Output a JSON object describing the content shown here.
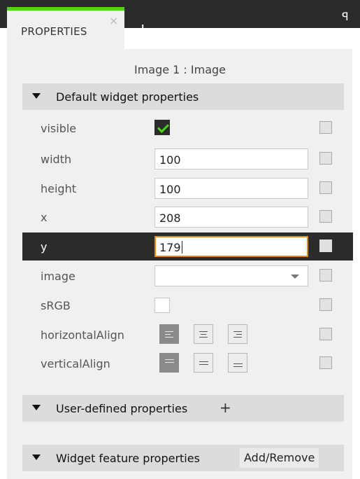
{
  "tab": {
    "label": "PROPERTIES",
    "close_glyph": "×",
    "add_glyph": "+",
    "pin_glyph": "ꟼ"
  },
  "colors": {
    "accent_green": "#4cd51a",
    "dark_bar": "#2b2b2b",
    "focus_orange": "#e08c1f",
    "panel_bg": "#f0f0f0"
  },
  "panel": {
    "title": "Image 1 : Image"
  },
  "sections": {
    "default": {
      "label": "Default widget properties"
    },
    "user_defined": {
      "label": "User-defined properties",
      "add_glyph": "+"
    },
    "feature": {
      "label": "Widget feature properties",
      "button": "Add/Remove"
    }
  },
  "properties": {
    "visible": {
      "label": "visible",
      "checked": true
    },
    "width": {
      "label": "width",
      "value": "100"
    },
    "height": {
      "label": "height",
      "value": "100"
    },
    "x": {
      "label": "x",
      "value": "208"
    },
    "y": {
      "label": "y",
      "value": "179",
      "selected": true,
      "focused": true
    },
    "image": {
      "label": "image",
      "value": ""
    },
    "srgb": {
      "label": "sRGB",
      "checked": false
    },
    "horizontal_align": {
      "label": "horizontalAlign",
      "options": [
        "left",
        "center",
        "right"
      ],
      "selected": "left"
    },
    "vertical_align": {
      "label": "verticalAlign",
      "options": [
        "top",
        "middle",
        "bottom"
      ],
      "selected": "top"
    }
  }
}
